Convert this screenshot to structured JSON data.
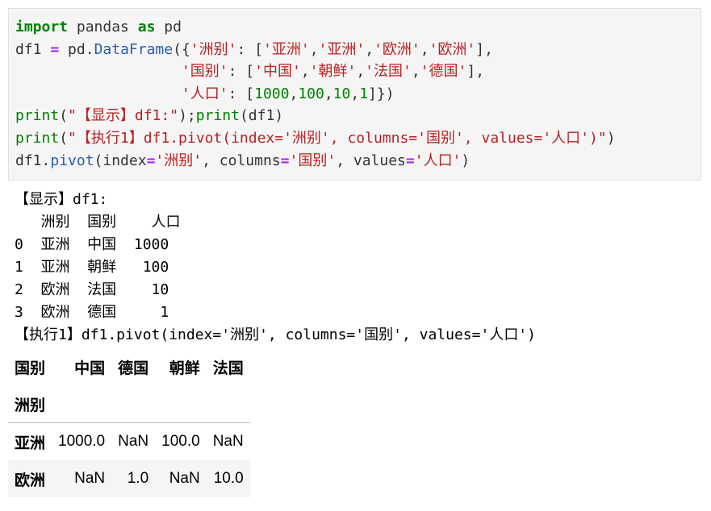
{
  "code_cell": {
    "line1": {
      "kw_import": "import",
      "t1": " pandas ",
      "kw_as": "as",
      "t2": " pd"
    },
    "line2": {
      "a": "df1 ",
      "op": "=",
      "b": " pd.",
      "attr": "DataFrame",
      "c": "({",
      "key": "'洲别'",
      "d": ": [",
      "v1": "'亚洲'",
      "v2": "'亚洲'",
      "v3": "'欧洲'",
      "v4": "'欧洲'",
      "e": "],"
    },
    "line3": {
      "indent": "                   ",
      "key": "'国别'",
      "d": ": [",
      "v1": "'中国'",
      "v2": "'朝鲜'",
      "v3": "'法国'",
      "v4": "'德国'",
      "e": "],"
    },
    "line4": {
      "indent": "                   ",
      "key": "'人口'",
      "d": ": [",
      "n1": "1000",
      "n2": "100",
      "n3": "10",
      "n4": "1",
      "e": "]})"
    },
    "line5": {
      "fn": "print",
      "s": "\"【显示】df1:\"",
      "a": ");",
      "fn2": "print",
      "b": "(df1)"
    },
    "line6": {
      "fn": "print",
      "s": "\"【执行1】df1.pivot(index='洲别', columns='国别', values='人口')\"",
      "e": ")"
    },
    "line7": {
      "a": "df1.",
      "attr": "pivot",
      "b": "(index",
      "s1": "'洲别'",
      "c": ", columns",
      "s2": "'国别'",
      "d": ", values",
      "s3": "'人口'",
      "e": ")"
    }
  },
  "printed_output": [
    "【显示】df1:",
    "   洲别  国别    人口",
    "0  亚洲  中国  1000",
    "1  亚洲  朝鲜   100",
    "2  欧洲  法国    10",
    "3  欧洲  德国     1",
    "【执行1】df1.pivot(index='洲别', columns='国别', values='人口')"
  ],
  "pivot_table": {
    "columns_name": "国别",
    "columns": [
      "中国",
      "德国",
      "朝鲜",
      "法国"
    ],
    "index_name": "洲别",
    "rows": [
      {
        "index": "亚洲",
        "values": [
          "1000.0",
          "NaN",
          "100.0",
          "NaN"
        ]
      },
      {
        "index": "欧洲",
        "values": [
          "NaN",
          "1.0",
          "NaN",
          "10.0"
        ]
      }
    ]
  }
}
